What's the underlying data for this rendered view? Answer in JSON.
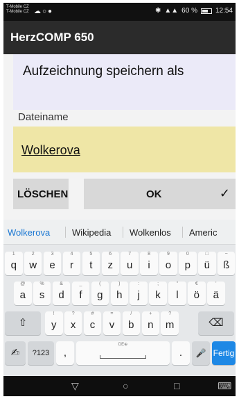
{
  "status_bar": {
    "carrier_line1": "T-Mobile CZ",
    "carrier_line2": "T-Mobile CZ",
    "battery": "60 %",
    "time": "12:54"
  },
  "app_bar": {
    "title": "HerzCOMP 650"
  },
  "dialog": {
    "heading": "Aufzeichnung speichern als",
    "filename_label": "Dateiname",
    "filename_value": "Wolkerova",
    "clear_label": "LÖSCHEN",
    "ok_label": "OK",
    "check_glyph": "✓"
  },
  "keyboard": {
    "suggestions": [
      "Wolkerova",
      "Wikipedia",
      "Wolkenlos",
      "Americ"
    ],
    "row1": [
      {
        "k": "q",
        "h": "1"
      },
      {
        "k": "w",
        "h": "2"
      },
      {
        "k": "e",
        "h": "3"
      },
      {
        "k": "r",
        "h": "4"
      },
      {
        "k": "t",
        "h": "5"
      },
      {
        "k": "z",
        "h": "6"
      },
      {
        "k": "u",
        "h": "7"
      },
      {
        "k": "i",
        "h": "8"
      },
      {
        "k": "o",
        "h": "9"
      },
      {
        "k": "p",
        "h": "0"
      },
      {
        "k": "ü",
        "h": "□"
      },
      {
        "k": "ß",
        "h": "~"
      }
    ],
    "row2": [
      {
        "k": "a",
        "h": "@"
      },
      {
        "k": "s",
        "h": "%"
      },
      {
        "k": "d",
        "h": "&"
      },
      {
        "k": "f",
        "h": "_"
      },
      {
        "k": "g",
        "h": "("
      },
      {
        "k": "h",
        "h": ")"
      },
      {
        "k": "j",
        "h": ":"
      },
      {
        "k": "k",
        "h": ";"
      },
      {
        "k": "l",
        "h": "\""
      },
      {
        "k": "ö",
        "h": "€"
      },
      {
        "k": "ä",
        "h": "'"
      }
    ],
    "row3": [
      {
        "k": "y",
        "h": "!"
      },
      {
        "k": "x",
        "h": "?"
      },
      {
        "k": "c",
        "h": "#"
      },
      {
        "k": "v",
        "h": "="
      },
      {
        "k": "b",
        "h": "/"
      },
      {
        "k": "n",
        "h": "+"
      },
      {
        "k": "m",
        "h": "?"
      }
    ],
    "shift_glyph": "⇧",
    "backspace_glyph": "⌫",
    "handwriting_glyph": "✍",
    "symbols_label": "?123",
    "comma": ",",
    "space_hint": "DE⊕",
    "period": ".",
    "mic_glyph": "🎤",
    "done_label": "Fertig"
  },
  "nav_bar": {
    "back": "▽",
    "home": "○",
    "recents": "□",
    "keyboard": "⌨"
  }
}
